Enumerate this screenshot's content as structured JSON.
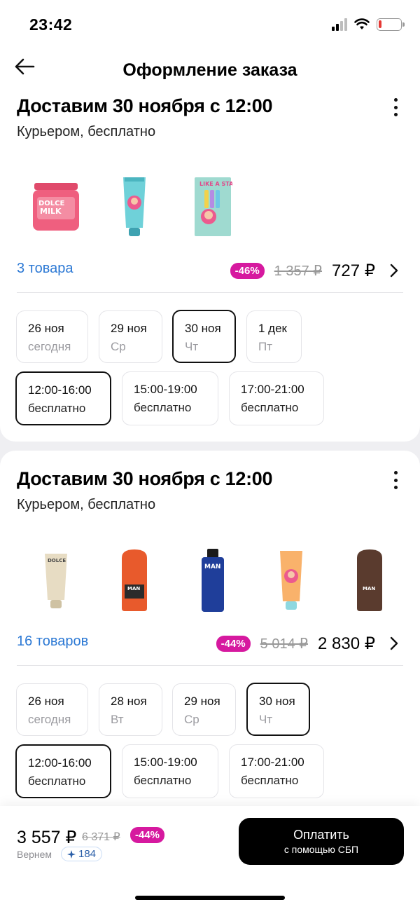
{
  "status": {
    "time": "23:42"
  },
  "header": {
    "title": "Оформление заказа"
  },
  "shipments": [
    {
      "title": "Доставим 30 ноября с 12:00",
      "subtitle": "Курьером, бесплатно",
      "items_count": "3 товара",
      "discount": "-46%",
      "old_price": "1 357 ₽",
      "price": "727 ₽",
      "dates": [
        {
          "day": "26 ноя",
          "sub": "сегодня"
        },
        {
          "day": "29 ноя",
          "sub": "Ср"
        },
        {
          "day": "30 ноя",
          "sub": "Чт"
        },
        {
          "day": "1 дек",
          "sub": "Пт"
        }
      ],
      "slots": [
        {
          "time": "12:00-16:00",
          "sub": "бесплатно"
        },
        {
          "time": "15:00-19:00",
          "sub": "бесплатно"
        },
        {
          "time": "17:00-21:00",
          "sub": "бесплатно"
        }
      ]
    },
    {
      "title": "Доставим 30 ноября с 12:00",
      "subtitle": "Курьером, бесплатно",
      "items_count": "16 товаров",
      "discount": "-44%",
      "old_price": "5 014 ₽",
      "price": "2 830 ₽",
      "dates": [
        {
          "day": "26 ноя",
          "sub": "сегодня"
        },
        {
          "day": "28 ноя",
          "sub": "Вт"
        },
        {
          "day": "29 ноя",
          "sub": "Ср"
        },
        {
          "day": "30 ноя",
          "sub": "Чт"
        }
      ],
      "slots": [
        {
          "time": "12:00-16:00",
          "sub": "бесплатно"
        },
        {
          "time": "15:00-19:00",
          "sub": "бесплатно"
        },
        {
          "time": "17:00-21:00",
          "sub": "бесплатно"
        }
      ]
    }
  ],
  "footer": {
    "total": "3 557 ₽",
    "old_total": "6 371 ₽",
    "discount": "-44%",
    "cashback_label": "Вернем",
    "cashback_points": "184",
    "pay_label": "Оплатить",
    "pay_sub": "с помощью СБП"
  },
  "colors": {
    "accent": "#d6199f",
    "link": "#2b78d4"
  }
}
